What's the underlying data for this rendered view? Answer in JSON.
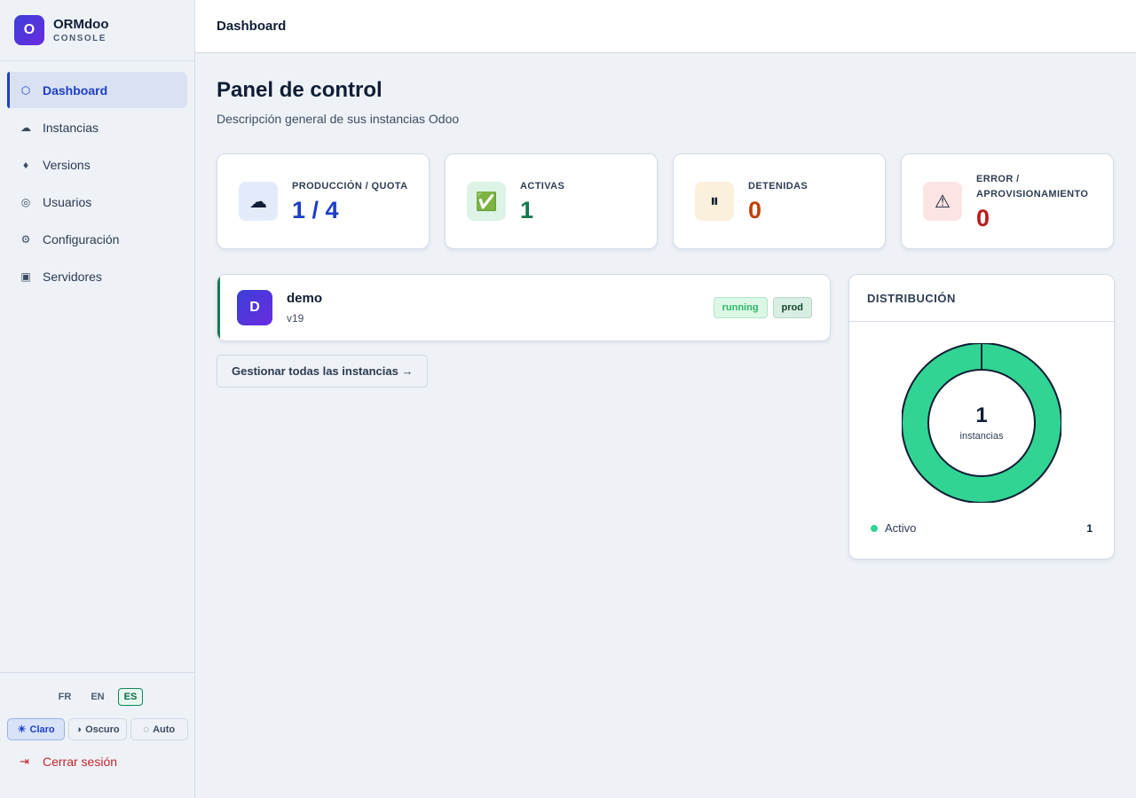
{
  "brand": {
    "logo_letter": "O",
    "name": "ORMdoo",
    "sub": "CONSOLE"
  },
  "nav": [
    {
      "label": "Dashboard",
      "icon": "hexagon-icon",
      "glyph": "⬡"
    },
    {
      "label": "Instancias",
      "icon": "cloud-icon",
      "glyph": "☁"
    },
    {
      "label": "Versions",
      "icon": "diamond-icon",
      "glyph": "♦"
    },
    {
      "label": "Usuarios",
      "icon": "user-circle-icon",
      "glyph": "◎"
    },
    {
      "label": "Configuración",
      "icon": "gear-icon",
      "glyph": "⚙"
    },
    {
      "label": "Servidores",
      "icon": "server-icon",
      "glyph": "▣"
    }
  ],
  "languages": [
    "FR",
    "EN",
    "ES"
  ],
  "selected_language": "ES",
  "themes": [
    {
      "label": "Claro",
      "glyph": "☀"
    },
    {
      "label": "Oscuro",
      "glyph": "◑"
    },
    {
      "label": "Auto",
      "glyph": "◌"
    }
  ],
  "selected_theme": "Claro",
  "logout": {
    "label": "Cerrar sesión",
    "glyph": "⇥"
  },
  "topbar": {
    "title": "Dashboard"
  },
  "page": {
    "title": "Panel de control",
    "subtitle": "Descripción general de sus instancias Odoo"
  },
  "stats": [
    {
      "label": "PRODUCCIÓN / QUOTA",
      "value": "1 / 4",
      "icon": "cloud-icon",
      "glyph": "☁",
      "icon_bg": "#e3ebfb",
      "value_color": "#1d3fc4"
    },
    {
      "label": "ACTIVAS",
      "value": "1",
      "icon": "check-icon",
      "glyph": "✅",
      "icon_bg": "#dcf3e6",
      "value_color": "#12784e"
    },
    {
      "label": "DETENIDAS",
      "value": "0",
      "icon": "pause-icon",
      "glyph": "⏸",
      "icon_bg": "#fbf0dc",
      "value_color": "#c2410c"
    },
    {
      "label": "ERROR / APROVISIONAMIENTO",
      "value": "0",
      "icon": "warning-icon",
      "glyph": "⚠",
      "icon_bg": "#fde4e4",
      "value_color": "#b91c1c"
    }
  ],
  "instances": [
    {
      "avatar": "D",
      "name": "demo",
      "version": "v19",
      "status": "running",
      "env": "prod"
    }
  ],
  "manage_button": "Gestionar todas las instancias →",
  "distribution": {
    "title": "DISTRIBUCIÓN",
    "total": "1",
    "total_label": "instancias",
    "legend": [
      {
        "name": "Activo",
        "value": "1",
        "color": "#31d493"
      }
    ]
  },
  "colors": {
    "accent": "#1d3fc4",
    "success": "#31d493",
    "danger": "#c0262d"
  }
}
